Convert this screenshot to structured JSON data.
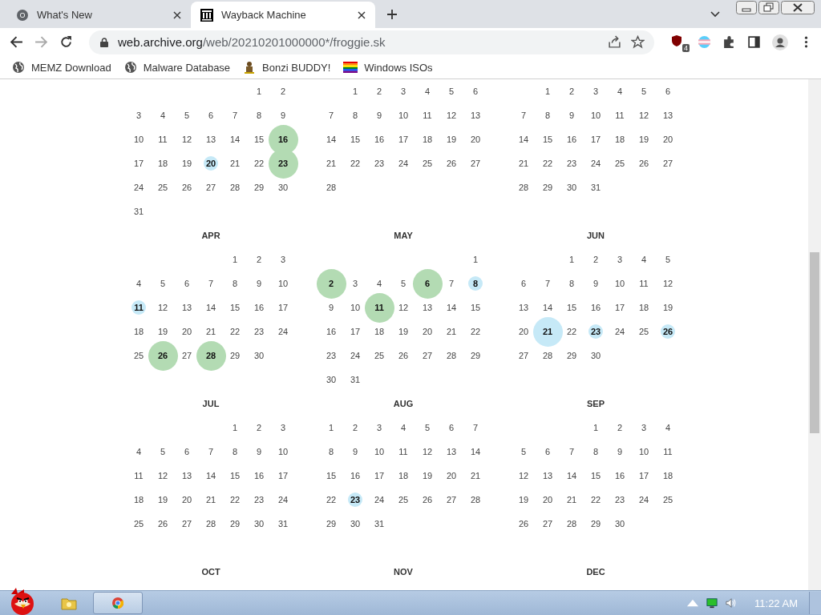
{
  "tabs": [
    {
      "title": "What's New",
      "kind": "chrome",
      "selected": false
    },
    {
      "title": "Wayback Machine",
      "kind": "archive",
      "selected": true
    }
  ],
  "address": {
    "host": "web.archive.org",
    "path": "/web/20210201000000*/froggie.sk"
  },
  "extension_badge": "4",
  "bookmarks": [
    {
      "label": "MEMZ Download",
      "kind": "globe"
    },
    {
      "label": "Malware Database",
      "kind": "globe"
    },
    {
      "label": "Bonzi BUDDY!",
      "kind": "character"
    },
    {
      "label": "Windows ISOs",
      "kind": "flag"
    }
  ],
  "months": [
    {
      "weeks": [
        [
          "1",
          "2"
        ],
        [
          "3",
          "4",
          "5",
          "6",
          "7",
          "8",
          "9"
        ],
        [
          "10",
          "11",
          "12",
          "13",
          "14",
          "15",
          {
            "day": "16",
            "large": true,
            "color": "#b3dbb3"
          }
        ],
        [
          "17",
          "18",
          "19",
          {
            "day": "20",
            "large": false,
            "color": "#c6e9f7"
          },
          "21",
          "22",
          {
            "day": "23",
            "large": true,
            "color": "#b3dbb3"
          }
        ],
        [
          "24",
          "25",
          "26",
          "27",
          "28",
          "29",
          "30"
        ],
        [
          "31"
        ]
      ]
    },
    {
      "weeks": [
        [
          "1",
          "2",
          "3",
          "4",
          "5",
          "6"
        ],
        [
          "7",
          "8",
          "9",
          "10",
          "11",
          "12",
          "13"
        ],
        [
          "14",
          "15",
          "16",
          "17",
          "18",
          "19",
          "20"
        ],
        [
          "21",
          "22",
          "23",
          "24",
          "25",
          "26",
          "27"
        ],
        [
          "28"
        ]
      ]
    },
    {
      "weeks": [
        [
          "1",
          "2",
          "3",
          "4",
          "5",
          "6"
        ],
        [
          "7",
          "8",
          "9",
          "10",
          "11",
          "12",
          "13"
        ],
        [
          "14",
          "15",
          "16",
          "17",
          "18",
          "19",
          "20"
        ],
        [
          "21",
          "22",
          "23",
          "24",
          "25",
          "26",
          "27"
        ],
        [
          "28",
          "29",
          "30",
          "31"
        ]
      ]
    },
    {
      "label": "APR",
      "weeks": [
        [
          "1",
          "2",
          "3"
        ],
        [
          "4",
          "5",
          "6",
          "7",
          "8",
          "9",
          "10"
        ],
        [
          {
            "day": "11",
            "large": false,
            "color": "#c6e9f7"
          },
          "12",
          "13",
          "14",
          "15",
          "16",
          "17"
        ],
        [
          "18",
          "19",
          "20",
          "21",
          "22",
          "23",
          "24"
        ],
        [
          "25",
          {
            "day": "26",
            "large": true,
            "color": "#b3dbb3"
          },
          "27",
          {
            "day": "28",
            "large": true,
            "color": "#b3dbb3"
          },
          "29",
          "30"
        ]
      ]
    },
    {
      "label": "MAY",
      "weeks": [
        [
          "1"
        ],
        [
          {
            "day": "2",
            "large": true,
            "color": "#b3dbb3"
          },
          "3",
          "4",
          "5",
          {
            "day": "6",
            "large": true,
            "color": "#b3dbb3"
          },
          "7",
          {
            "day": "8",
            "large": false,
            "color": "#c6e9f7"
          }
        ],
        [
          "9",
          "10",
          {
            "day": "11",
            "large": true,
            "color": "#b3dbb3"
          },
          "12",
          "13",
          "14",
          "15"
        ],
        [
          "16",
          "17",
          "18",
          "19",
          "20",
          "21",
          "22"
        ],
        [
          "23",
          "24",
          "25",
          "26",
          "27",
          "28",
          "29"
        ],
        [
          "30",
          "31"
        ]
      ]
    },
    {
      "label": "JUN",
      "weeks": [
        [
          "1",
          "2",
          "3",
          "4",
          "5"
        ],
        [
          "6",
          "7",
          "8",
          "9",
          "10",
          "11",
          "12"
        ],
        [
          "13",
          "14",
          "15",
          "16",
          "17",
          "18",
          "19"
        ],
        [
          "20",
          {
            "day": "21",
            "large": true,
            "color": "#c6e9f7"
          },
          "22",
          {
            "day": "23",
            "large": false,
            "color": "#c6e9f7"
          },
          "24",
          "25",
          {
            "day": "26",
            "large": false,
            "color": "#c6e9f7"
          }
        ],
        [
          "27",
          "28",
          "29",
          "30"
        ]
      ]
    },
    {
      "label": "JUL",
      "weeks": [
        [
          "1",
          "2",
          "3"
        ],
        [
          "4",
          "5",
          "6",
          "7",
          "8",
          "9",
          "10"
        ],
        [
          "11",
          "12",
          "13",
          "14",
          "15",
          "16",
          "17"
        ],
        [
          "18",
          "19",
          "20",
          "21",
          "22",
          "23",
          "24"
        ],
        [
          "25",
          "26",
          "27",
          "28",
          "29",
          "30",
          "31"
        ]
      ]
    },
    {
      "label": "AUG",
      "weeks": [
        [
          "1",
          "2",
          "3",
          "4",
          "5",
          "6",
          "7"
        ],
        [
          "8",
          "9",
          "10",
          "11",
          "12",
          "13",
          "14"
        ],
        [
          "15",
          "16",
          "17",
          "18",
          "19",
          "20",
          "21"
        ],
        [
          "22",
          {
            "day": "23",
            "large": false,
            "color": "#c6e9f7"
          },
          "24",
          "25",
          "26",
          "27",
          "28"
        ],
        [
          "29",
          "30",
          "31"
        ]
      ]
    },
    {
      "label": "SEP",
      "weeks": [
        [
          "1",
          "2",
          "3",
          "4"
        ],
        [
          "5",
          "6",
          "7",
          "8",
          "9",
          "10",
          "11"
        ],
        [
          "12",
          "13",
          "14",
          "15",
          "16",
          "17",
          "18"
        ],
        [
          "19",
          "20",
          "21",
          "22",
          "23",
          "24",
          "25"
        ],
        [
          "26",
          "27",
          "28",
          "29",
          "30"
        ]
      ]
    },
    {
      "label": "OCT"
    },
    {
      "label": "NOV"
    },
    {
      "label": "DEC"
    }
  ],
  "taskbar": {
    "clock": "11:22 AM"
  }
}
